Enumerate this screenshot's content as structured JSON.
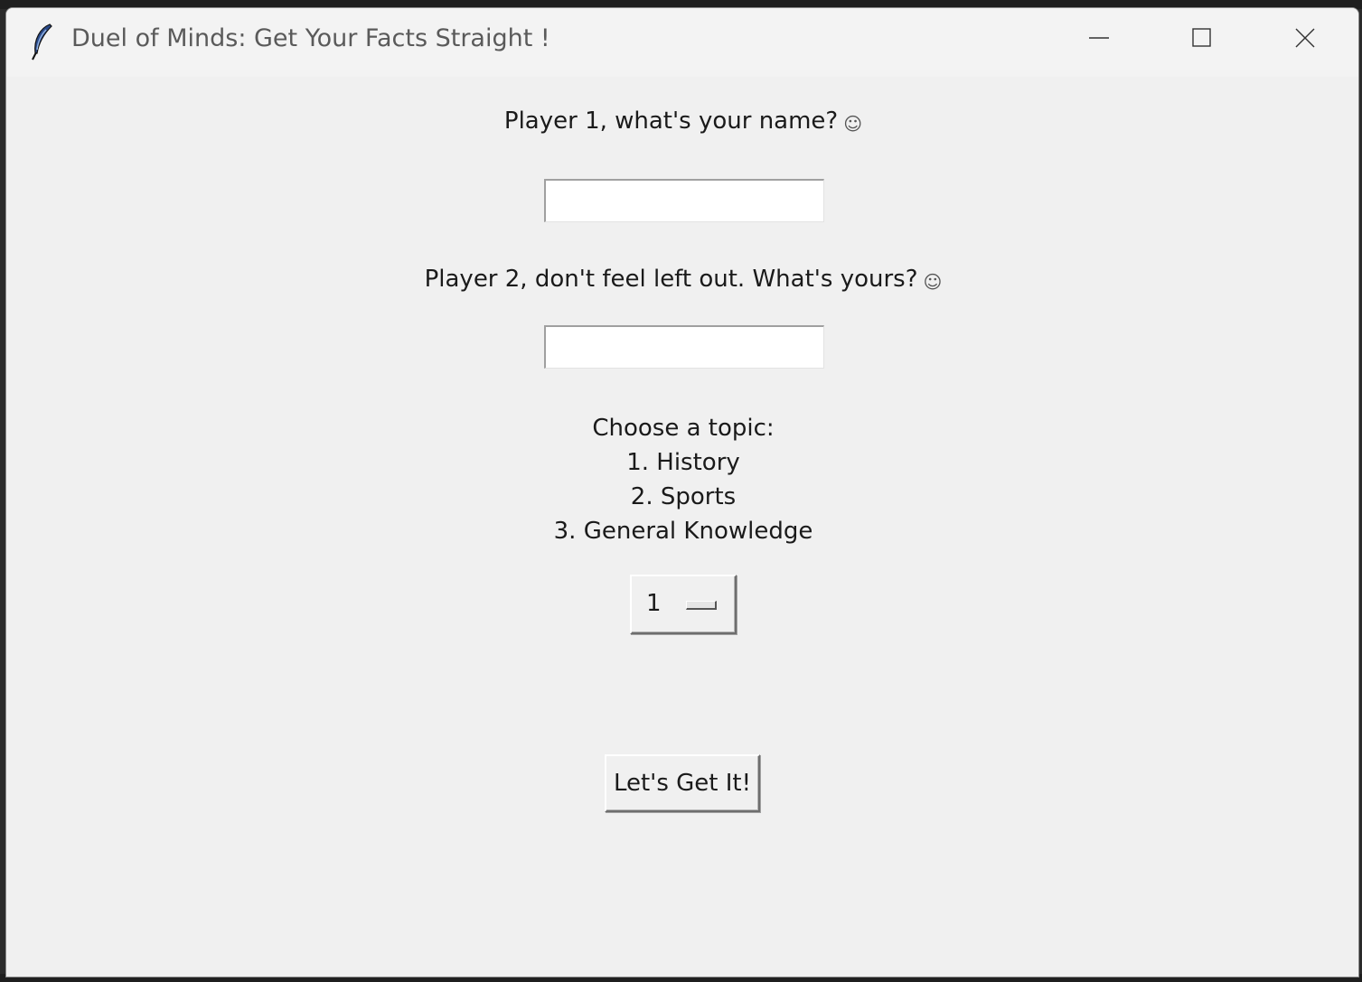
{
  "window": {
    "title": "Duel of Minds: Get Your Facts Straight !",
    "icon": "feather-icon",
    "controls": {
      "minimize": "minimize-icon",
      "maximize": "maximize-icon",
      "close": "close-icon"
    }
  },
  "form": {
    "player1_label": "Player 1, what's your name?",
    "player1_emoji": "☺",
    "player1_value": "",
    "player2_label": "Player 2, don't feel left out. What's yours?",
    "player2_emoji": "☺",
    "player2_value": "",
    "topics_heading": "Choose a topic:",
    "topics": [
      "1. History",
      "2. Sports",
      "3. General Knowledge"
    ],
    "topic_selected": "1",
    "start_button": "Let's Get It!"
  },
  "colors": {
    "window_bg": "#f0f0f0",
    "titlebar_bg": "#f3f3f3",
    "title_text": "#5a5a5a"
  }
}
